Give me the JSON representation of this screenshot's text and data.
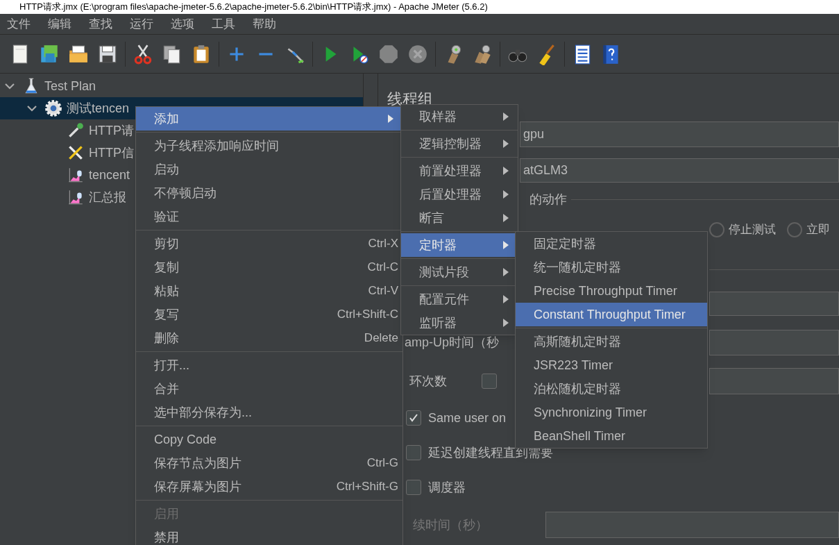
{
  "window": {
    "title": "HTTP请求.jmx (E:\\program files\\apache-jmeter-5.6.2\\apache-jmeter-5.6.2\\bin\\HTTP请求.jmx) - Apache JMeter (5.6.2)"
  },
  "menu_bar": [
    "文件",
    "编辑",
    "查找",
    "运行",
    "选项",
    "工具",
    "帮助"
  ],
  "toolbar": [
    {
      "kind": "new",
      "disabled": false
    },
    {
      "kind": "templates",
      "disabled": false
    },
    {
      "kind": "open",
      "disabled": false
    },
    {
      "kind": "save",
      "disabled": false
    },
    {
      "kind": "separator"
    },
    {
      "kind": "cut",
      "disabled": false
    },
    {
      "kind": "copy",
      "disabled": false
    },
    {
      "kind": "paste",
      "disabled": false
    },
    {
      "kind": "separator"
    },
    {
      "kind": "expand",
      "disabled": false
    },
    {
      "kind": "collapse",
      "disabled": false
    },
    {
      "kind": "toggle",
      "disabled": false
    },
    {
      "kind": "separator"
    },
    {
      "kind": "start",
      "disabled": false
    },
    {
      "kind": "start_no_pause",
      "disabled": false
    },
    {
      "kind": "stop",
      "disabled": true
    },
    {
      "kind": "shutdown",
      "disabled": true
    },
    {
      "kind": "separator"
    },
    {
      "kind": "clear",
      "disabled": false
    },
    {
      "kind": "clear_all",
      "disabled": false
    },
    {
      "kind": "separator"
    },
    {
      "kind": "search",
      "disabled": false
    },
    {
      "kind": "reset_search",
      "disabled": false
    },
    {
      "kind": "separator"
    },
    {
      "kind": "functions",
      "disabled": false
    },
    {
      "kind": "help",
      "disabled": false
    }
  ],
  "tree": [
    {
      "label": "Test Plan",
      "kind": "plan",
      "expanded": true,
      "selected": false,
      "children": [
        {
          "label": "测试tencen",
          "kind": "thread_group",
          "expanded": true,
          "selected": true,
          "children": [
            {
              "label": "HTTP请",
              "kind": "sampler",
              "selected": false
            },
            {
              "label": "HTTP信",
              "kind": "config",
              "selected": false
            },
            {
              "label": "tencent",
              "kind": "listener",
              "selected": false
            },
            {
              "label": "汇总报",
              "kind": "listener",
              "selected": false
            }
          ]
        }
      ]
    }
  ],
  "panel": {
    "title": "线程组",
    "name_value": "gpu",
    "comment_value": "atGLM3",
    "action_legend": "的动作",
    "radios": [
      {
        "label": "停止测试",
        "selected": false
      },
      {
        "label": "立即",
        "selected": false
      }
    ],
    "ramp_up_label": "amp-Up时间（秒",
    "loop_label": "环次数",
    "loop_forever_checked": false,
    "checkboxes": [
      {
        "label": "Same user on",
        "checked": true
      },
      {
        "label": "延迟创建线程直到需要",
        "checked": false
      },
      {
        "label": "调度器",
        "checked": false
      }
    ],
    "duration_label": "续时间（秒）",
    "duration_disabled": true
  },
  "context_menu": [
    {
      "kind": "item",
      "label": "添加",
      "selected": true,
      "submenu": true,
      "disabled": false
    },
    {
      "kind": "separator"
    },
    {
      "kind": "item",
      "label": "为子线程添加响应时间",
      "selected": false,
      "submenu": false,
      "disabled": false
    },
    {
      "kind": "item",
      "label": "启动",
      "selected": false,
      "submenu": false,
      "disabled": false
    },
    {
      "kind": "item",
      "label": "不停顿启动",
      "selected": false,
      "submenu": false,
      "disabled": false
    },
    {
      "kind": "item",
      "label": "验证",
      "selected": false,
      "submenu": false,
      "disabled": false
    },
    {
      "kind": "separator"
    },
    {
      "kind": "item",
      "label": "剪切",
      "shortcut": "Ctrl-X",
      "selected": false,
      "submenu": false,
      "disabled": false
    },
    {
      "kind": "item",
      "label": "复制",
      "shortcut": "Ctrl-C",
      "selected": false,
      "submenu": false,
      "disabled": false
    },
    {
      "kind": "item",
      "label": "粘贴",
      "shortcut": "Ctrl-V",
      "selected": false,
      "submenu": false,
      "disabled": false
    },
    {
      "kind": "item",
      "label": "复写",
      "shortcut": "Ctrl+Shift-C",
      "selected": false,
      "submenu": false,
      "disabled": false
    },
    {
      "kind": "item",
      "label": "删除",
      "shortcut": "Delete",
      "selected": false,
      "submenu": false,
      "disabled": false
    },
    {
      "kind": "separator"
    },
    {
      "kind": "item",
      "label": "打开...",
      "selected": false,
      "submenu": false,
      "disabled": false
    },
    {
      "kind": "item",
      "label": "合并",
      "selected": false,
      "submenu": false,
      "disabled": false
    },
    {
      "kind": "item",
      "label": "选中部分保存为...",
      "selected": false,
      "submenu": false,
      "disabled": false
    },
    {
      "kind": "separator"
    },
    {
      "kind": "item",
      "label": "Copy Code",
      "selected": false,
      "submenu": false,
      "disabled": false
    },
    {
      "kind": "item",
      "label": "保存节点为图片",
      "shortcut": "Ctrl-G",
      "selected": false,
      "submenu": false,
      "disabled": false
    },
    {
      "kind": "item",
      "label": "保存屏幕为图片",
      "shortcut": "Ctrl+Shift-G",
      "selected": false,
      "submenu": false,
      "disabled": false
    },
    {
      "kind": "separator"
    },
    {
      "kind": "item",
      "label": "启用",
      "selected": false,
      "submenu": false,
      "disabled": true
    },
    {
      "kind": "item",
      "label": "禁用",
      "selected": false,
      "submenu": false,
      "disabled": false
    }
  ],
  "add_menu": [
    {
      "kind": "item",
      "label": "取样器",
      "selected": false,
      "submenu": true,
      "disabled": false
    },
    {
      "kind": "separator"
    },
    {
      "kind": "item",
      "label": "逻辑控制器",
      "selected": false,
      "submenu": true,
      "disabled": false
    },
    {
      "kind": "separator"
    },
    {
      "kind": "item",
      "label": "前置处理器",
      "selected": false,
      "submenu": true,
      "disabled": false
    },
    {
      "kind": "item",
      "label": "后置处理器",
      "selected": false,
      "submenu": true,
      "disabled": false
    },
    {
      "kind": "item",
      "label": "断言",
      "selected": false,
      "submenu": true,
      "disabled": false
    },
    {
      "kind": "separator"
    },
    {
      "kind": "item",
      "label": "定时器",
      "selected": true,
      "submenu": true,
      "disabled": false
    },
    {
      "kind": "separator"
    },
    {
      "kind": "item",
      "label": "测试片段",
      "selected": false,
      "submenu": true,
      "disabled": false
    },
    {
      "kind": "separator"
    },
    {
      "kind": "item",
      "label": "配置元件",
      "selected": false,
      "submenu": true,
      "disabled": false
    },
    {
      "kind": "item",
      "label": "监听器",
      "selected": false,
      "submenu": true,
      "disabled": false
    }
  ],
  "timer_menu": [
    {
      "kind": "item",
      "label": "固定定时器",
      "selected": false,
      "submenu": false,
      "disabled": false
    },
    {
      "kind": "item",
      "label": "统一随机定时器",
      "selected": false,
      "submenu": false,
      "disabled": false
    },
    {
      "kind": "item",
      "label": "Precise Throughput Timer",
      "selected": false,
      "submenu": false,
      "disabled": false
    },
    {
      "kind": "item",
      "label": "Constant Throughput Timer",
      "selected": true,
      "submenu": false,
      "disabled": false
    },
    {
      "kind": "separator"
    },
    {
      "kind": "item",
      "label": "高斯随机定时器",
      "selected": false,
      "submenu": false,
      "disabled": false
    },
    {
      "kind": "item",
      "label": "JSR223 Timer",
      "selected": false,
      "submenu": false,
      "disabled": false
    },
    {
      "kind": "item",
      "label": "泊松随机定时器",
      "selected": false,
      "submenu": false,
      "disabled": false
    },
    {
      "kind": "item",
      "label": "Synchronizing Timer",
      "selected": false,
      "submenu": false,
      "disabled": false
    },
    {
      "kind": "item",
      "label": "BeanShell Timer",
      "selected": false,
      "submenu": false,
      "disabled": false
    }
  ]
}
